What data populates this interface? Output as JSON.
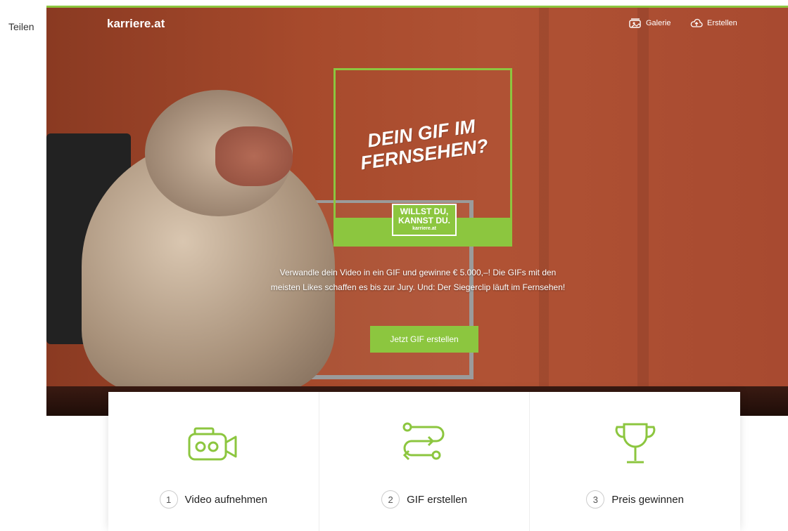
{
  "share": {
    "label": "Teilen"
  },
  "header": {
    "logo": "karriere.at",
    "nav": [
      {
        "label": "Galerie",
        "icon": "gallery-icon"
      },
      {
        "label": "Erstellen",
        "icon": "cloud-upload-icon"
      }
    ]
  },
  "hero": {
    "headline_line1": "DEIN GIF IM",
    "headline_line2": "FERNSEHEN?",
    "badge_line1": "WILLST DU,",
    "badge_line2": "KANNST DU.",
    "badge_line3": "karriere.at",
    "intro": "Verwandle dein Video in ein GIF und gewinne € 5.000,–! Die GIFs mit den meisten Likes schaffen es bis zur Jury. Und: Der Siegerclip läuft im Fernsehen!",
    "cta": "Jetzt GIF erstellen"
  },
  "steps": [
    {
      "number": "1",
      "label": "Video aufnehmen",
      "icon": "video-camera-icon"
    },
    {
      "number": "2",
      "label": "GIF erstellen",
      "icon": "path-arrows-icon"
    },
    {
      "number": "3",
      "label": "Preis gewinnen",
      "icon": "trophy-icon"
    }
  ],
  "colors": {
    "accent": "#8cc63f",
    "hero": "#a74a2c"
  }
}
